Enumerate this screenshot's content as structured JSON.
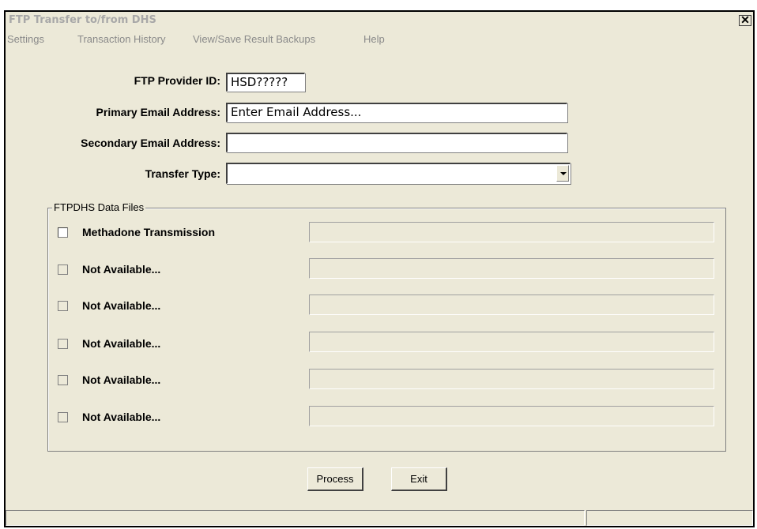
{
  "window": {
    "title": "FTP Transfer to/from DHS",
    "close_glyph": "✕"
  },
  "menu": [
    "Settings",
    "Transaction History",
    "View/Save Result Backups",
    "Help"
  ],
  "form": {
    "provider_id_label": "FTP Provider ID:",
    "provider_id_value": "HSD?????",
    "primary_email_label": "Primary Email Address:",
    "primary_email_value": "Enter Email Address...",
    "secondary_email_label": "Secondary Email Address:",
    "secondary_email_value": "",
    "transfer_type_label": "Transfer Type:",
    "transfer_type_value": ""
  },
  "files_group": {
    "legend": "FTPDHS Data Files",
    "rows": [
      {
        "label": "Methadone Transmission",
        "enabled": true,
        "checked": false,
        "value": ""
      },
      {
        "label": "Not Available...",
        "enabled": false,
        "checked": false,
        "value": ""
      },
      {
        "label": "Not Available...",
        "enabled": false,
        "checked": false,
        "value": ""
      },
      {
        "label": "Not Available...",
        "enabled": false,
        "checked": false,
        "value": ""
      },
      {
        "label": "Not Available...",
        "enabled": false,
        "checked": false,
        "value": ""
      },
      {
        "label": "Not Available...",
        "enabled": false,
        "checked": false,
        "value": ""
      }
    ]
  },
  "buttons": {
    "process": "Process",
    "exit": "Exit"
  },
  "icons": {
    "close": "close-icon",
    "dropdown": "chevron-down-icon"
  }
}
